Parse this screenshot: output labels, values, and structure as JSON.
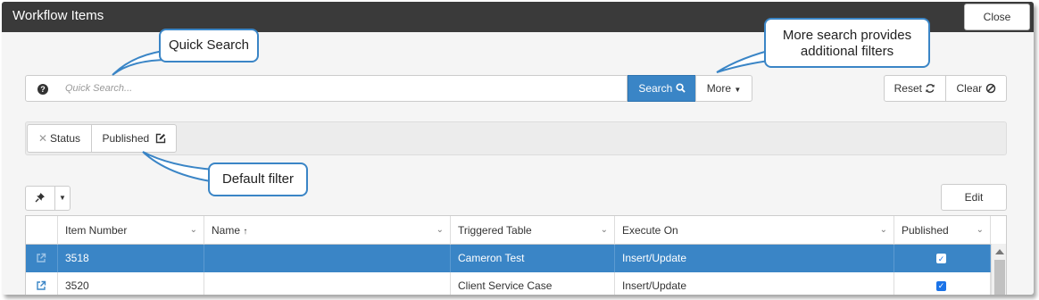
{
  "window": {
    "title": "Workflow Items",
    "close_label": "Close"
  },
  "search": {
    "placeholder": "Quick Search...",
    "search_label": "Search",
    "more_label": "More",
    "reset_label": "Reset",
    "clear_label": "Clear"
  },
  "filters": {
    "status_label": "Status",
    "published_label": "Published"
  },
  "toolbar": {
    "edit_label": "Edit"
  },
  "grid": {
    "columns": [
      "Item Number",
      "Name",
      "Triggered Table",
      "Execute On",
      "Published"
    ],
    "name_sort": "ascending",
    "rows": [
      {
        "item_number": "3518",
        "name": "",
        "triggered_table": "Cameron Test",
        "execute_on": "Insert/Update",
        "published": true,
        "selected": true
      },
      {
        "item_number": "3520",
        "name": "",
        "triggered_table": "Client Service Case",
        "execute_on": "Insert/Update",
        "published": true,
        "selected": false
      }
    ]
  },
  "callouts": {
    "quick_search": "Quick Search",
    "more_search_line1": "More search provides",
    "more_search_line2": "additional filters",
    "default_filter": "Default filter"
  },
  "colors": {
    "titlebar": "#3a3a3a",
    "accent": "#3a85c6",
    "selected_row": "#3a85c6",
    "checkbox": "#1a73e8"
  },
  "icons": {
    "help": "question-circle-icon",
    "search": "magnifier-icon",
    "more": "caret-down-icon",
    "reset": "refresh-icon",
    "clear": "ban-icon",
    "status_remove": "x-icon",
    "published_edit": "edit-square-icon",
    "pin": "pushpin-icon",
    "row_open": "external-link-icon"
  }
}
